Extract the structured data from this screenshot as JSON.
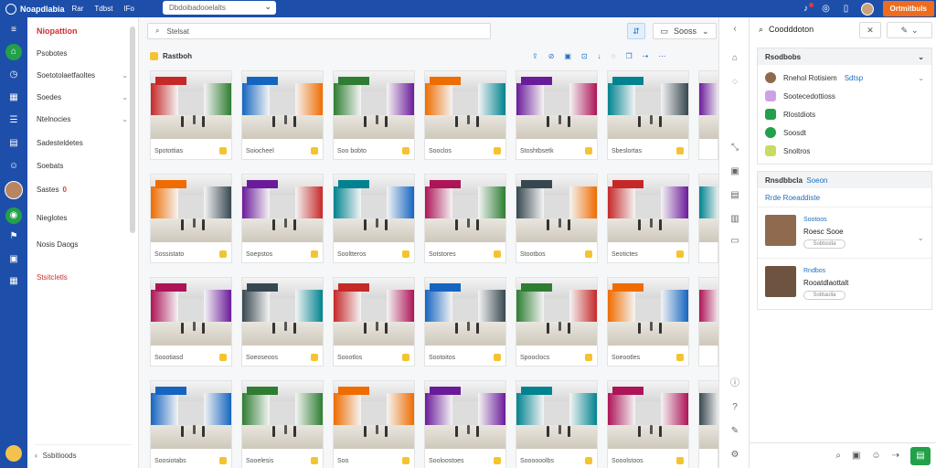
{
  "topbar": {
    "brand": "Noapdlabia",
    "menu": [
      "Rar",
      "Tdbst",
      "IFo"
    ],
    "search_placeholder": "Dbdoibadooelalts",
    "cta_label": "Ortmitbuls"
  },
  "nav": {
    "title": "Niopattion",
    "items": [
      {
        "label": "Psobotes",
        "chev": ""
      },
      {
        "label": "Soetotolaetfaoltes",
        "chev": "⌄"
      },
      {
        "label": "Soedes",
        "chev": "⌄"
      },
      {
        "label": "Ntelnocies",
        "chev": "⌄"
      },
      {
        "label": "Sadesteldetes",
        "chev": ""
      },
      {
        "label": "Soebats",
        "chev": ""
      },
      {
        "label": "Sastes",
        "chev": "",
        "badge": "0"
      },
      {
        "label": "Nieglotes",
        "chev": ""
      },
      {
        "label": "Nosis Daogs",
        "chev": ""
      },
      {
        "label": "Stsitcletls",
        "chev": "",
        "red": true
      }
    ],
    "footer_label": "Ssbitioods"
  },
  "main": {
    "search_placeholder": "Stelsat",
    "sort_label": "Sooss",
    "section_label": "Rastboh",
    "cards": [
      "Spotottias",
      "Soiocheel",
      "Soo bobto",
      "Sooclos",
      "Stoshtbsetk",
      "Sbeslortas",
      "Sossistato",
      "Soepstos",
      "Sooltteros",
      "Sotstores",
      "Stootbos",
      "Seotictes",
      "Soootiasd",
      "Soeoseoos",
      "Soootlos",
      "Sootoitos",
      "Spooclocs",
      "Soeootles",
      "Soosiotabs",
      "Sooelesis",
      "Soo",
      "Sooloostoes",
      "Soooooolbs",
      "Sooolstoos"
    ]
  },
  "rpanel": {
    "title": "Coodddoton",
    "group1": {
      "header": "Rsodbobs",
      "rows": [
        {
          "label": "Rnehol Rotisiem",
          "tag": "Sdtsp"
        },
        {
          "label": "Sootecedottioss",
          "tag": ""
        },
        {
          "label": "Rlostdiots",
          "tag": ""
        },
        {
          "label": "Soosdt",
          "tag": ""
        },
        {
          "label": "Snoltros",
          "tag": ""
        }
      ]
    },
    "group2": {
      "header": "Rnsdbbcla",
      "header_tag": "Soeon",
      "subtitle": "Rrde Roeaddiste",
      "people": [
        {
          "name": "Sootoos",
          "sub": "Roesc Sooe",
          "pill": "Sobtostla"
        },
        {
          "name": "Rndbos",
          "sub": "Rooatdlaottalt",
          "pill": "Sobtaolla"
        }
      ]
    }
  },
  "colors": {
    "brand_blue": "#1d4faa",
    "accent_orange": "#ef6c1e",
    "active_green": "#22a04a",
    "title_red": "#d32f2f"
  }
}
